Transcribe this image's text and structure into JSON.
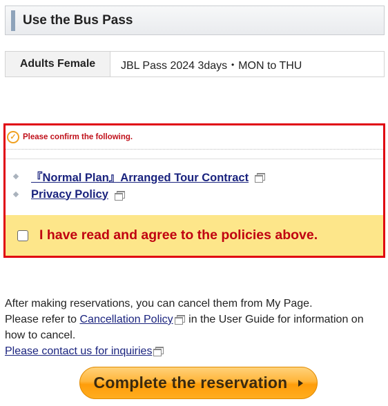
{
  "header": {
    "title": "Use the Bus Pass"
  },
  "pass": {
    "category": "Adults Female",
    "name": "JBL Pass 2024 3days・MON to THU"
  },
  "confirm": {
    "heading": "Please confirm the following.",
    "links": [
      {
        "label": "『Normal Plan』Arranged Tour Contract"
      },
      {
        "label": "Privacy Policy"
      }
    ],
    "agree_label": "I have read and agree to the policies above."
  },
  "info": {
    "line1": "After making reservations, you can cancel them from My Page.",
    "line2_pre": "Please refer to ",
    "cancellation_link": "Cancellation Policy",
    "line2_post": " in the User Guide for information on how to cancel.",
    "contact_link": "Please contact us for inquiries"
  },
  "actions": {
    "complete_label": "Complete the reservation"
  },
  "colors": {
    "accent_red": "#e00010",
    "agree_band": "#fde68a",
    "button_orange": "#ffa51c",
    "link_blue": "#1a237e"
  }
}
